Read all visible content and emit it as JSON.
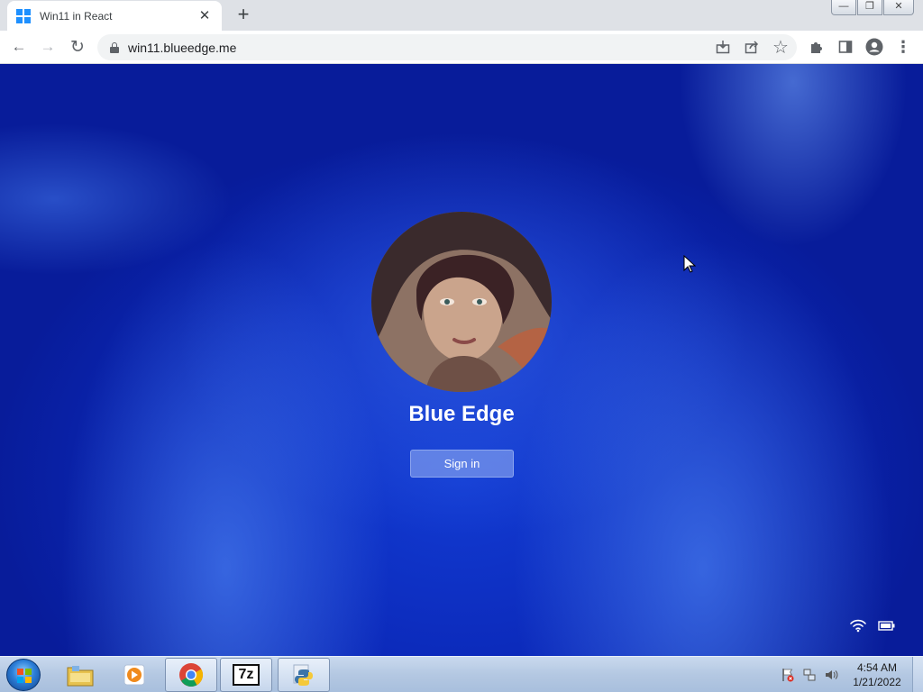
{
  "browser": {
    "tab": {
      "title": "Win11 in React",
      "close_glyph": "✕"
    },
    "new_tab_glyph": "+",
    "window_controls": {
      "minimize": "—",
      "restore": "❐",
      "close": "✕"
    },
    "nav": {
      "back": "←",
      "forward": "→",
      "reload": "↻"
    },
    "address": {
      "url": "win11.blueedge.me"
    },
    "actions": {
      "install": "install-icon",
      "share": "share-icon",
      "bookmark": "☆",
      "extensions": "puzzle-icon",
      "side_panel": "side-panel-icon",
      "profile": "profile-icon",
      "menu": "⋮"
    }
  },
  "lockscreen": {
    "user_name": "Blue Edge",
    "sign_in_label": "Sign in",
    "tray": {
      "wifi": "wifi-icon",
      "battery": "battery-icon"
    }
  },
  "taskbar": {
    "start": "windows-start-orb",
    "items": [
      {
        "name": "file-explorer",
        "active": false
      },
      {
        "name": "media-player",
        "active": false
      },
      {
        "name": "chrome",
        "active": true
      },
      {
        "name": "7zip",
        "label": "7z",
        "active": true
      },
      {
        "name": "python",
        "active": true
      }
    ],
    "clock": {
      "time": "4:54 AM",
      "date": "1/21/2022"
    }
  },
  "colors": {
    "wallpaper_blue": "#0a25b4",
    "sign_in_button": "#7896eb",
    "taskbar": "#b4c8e2"
  }
}
